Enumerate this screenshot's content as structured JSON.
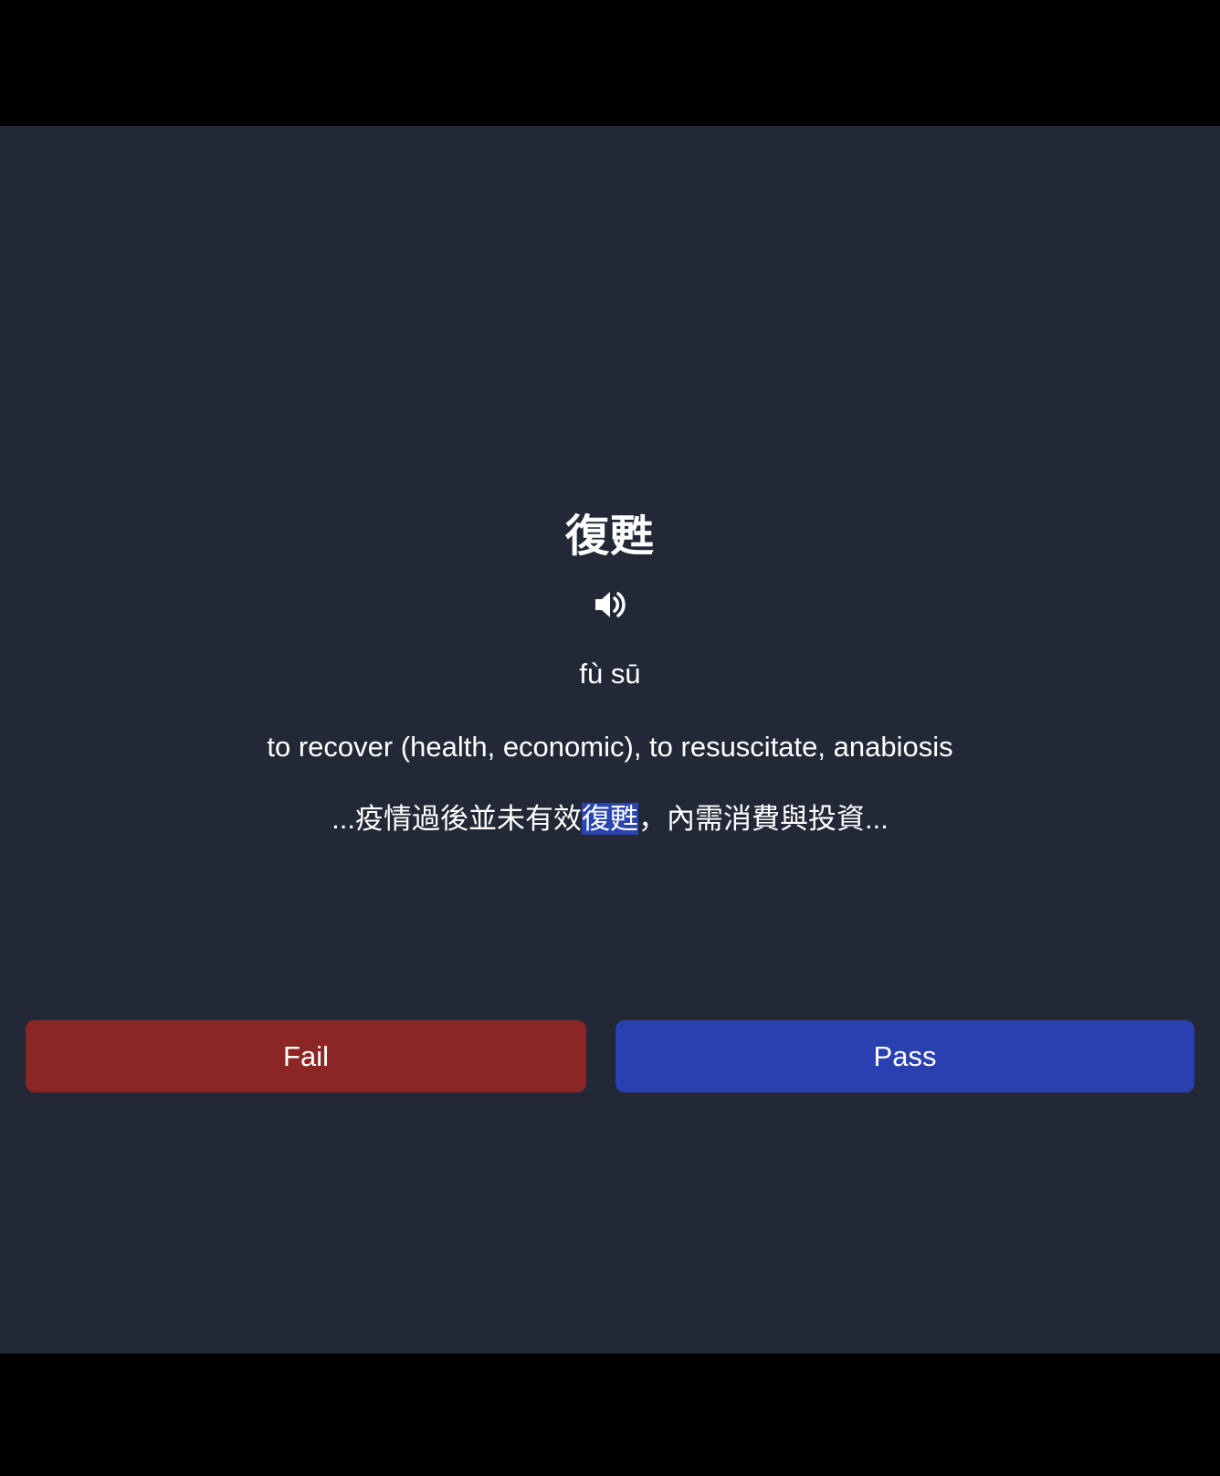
{
  "card": {
    "hanzi": "復甦",
    "pinyin": "fù sū",
    "definition": "to recover (health, economic), to resuscitate, anabiosis",
    "example": {
      "before": "...疫情過後並未有效",
      "highlight": "復甦",
      "after": "，內需消費與投資..."
    },
    "audio_icon": "speaker-volume-icon"
  },
  "actions": {
    "fail_label": "Fail",
    "pass_label": "Pass"
  },
  "colors": {
    "background": "#222836",
    "letterbox": "#000000",
    "fail": "#8c2624",
    "pass": "#2a3fb0",
    "highlight": "#2a45b0",
    "text": "#ffffff"
  }
}
